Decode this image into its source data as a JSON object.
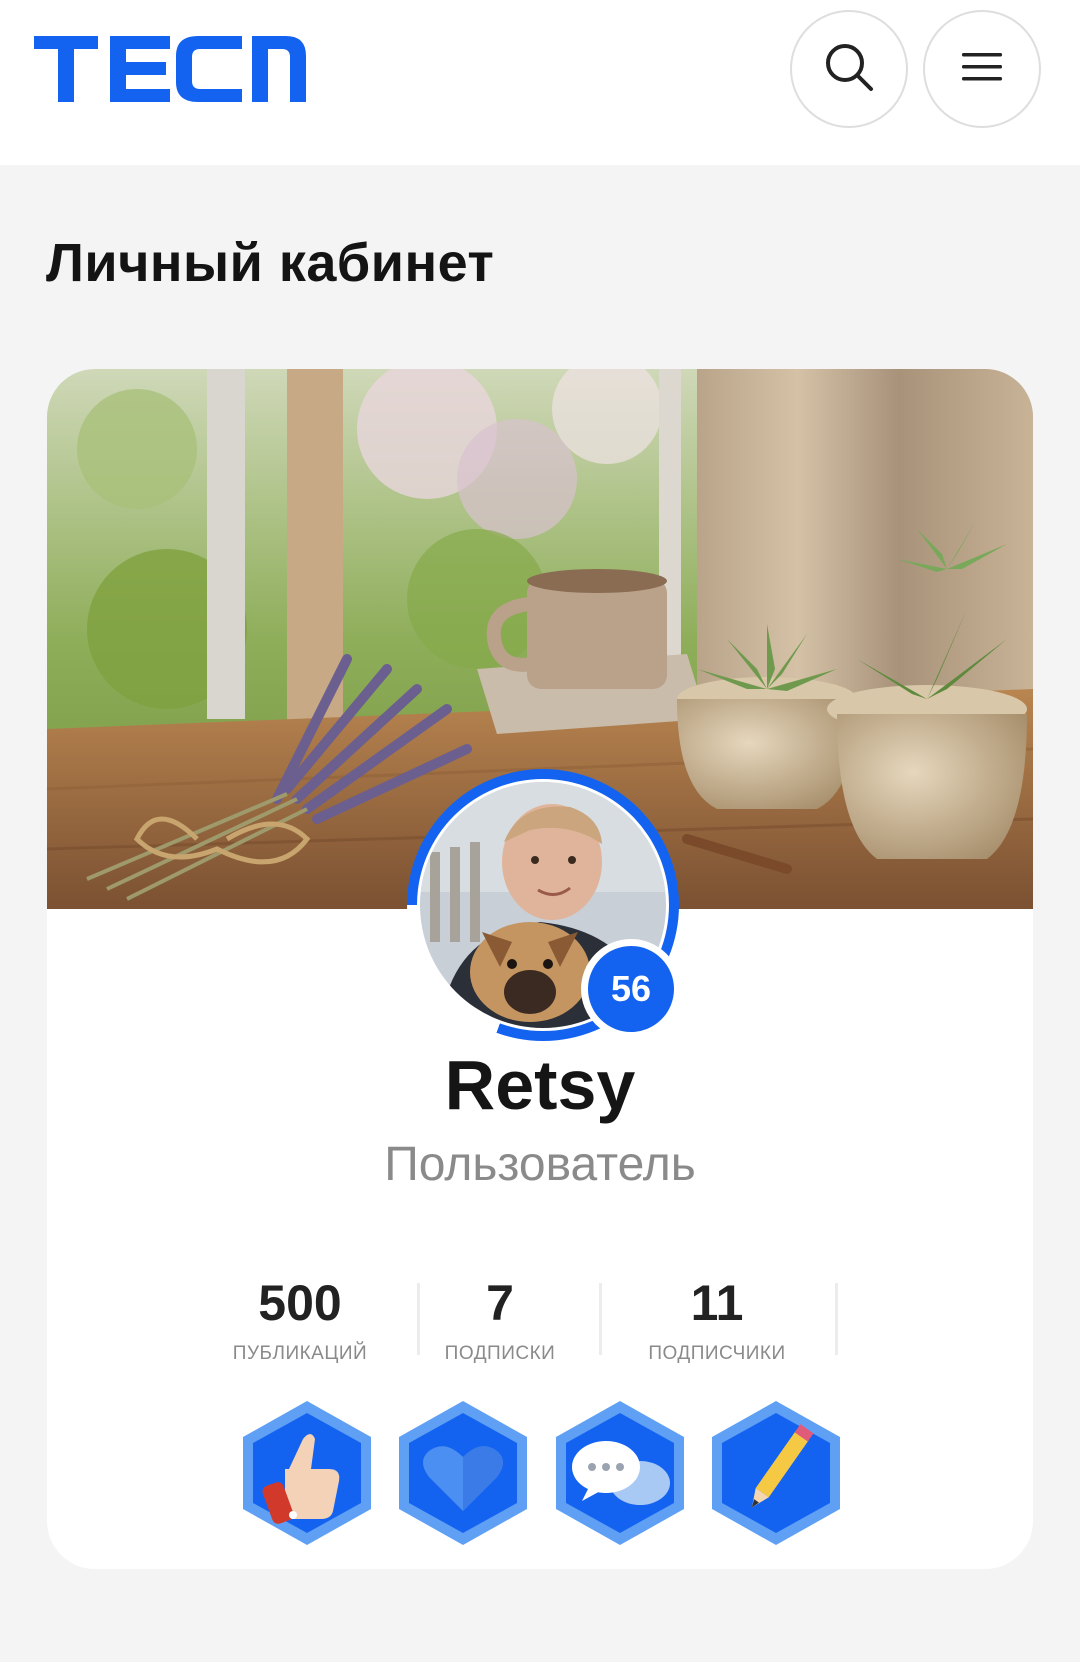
{
  "brand": {
    "logo_text": "TECNO",
    "accent_color": "#1463f0"
  },
  "header": {
    "search_icon": "search-icon",
    "menu_icon": "hamburger-menu-icon"
  },
  "page": {
    "title": "Личный кабинет"
  },
  "profile": {
    "cover_image": "cover-photo-lavender-succulents-coffee",
    "avatar_image": "avatar-photo-man-with-dog",
    "level": "56",
    "username": "Retsy",
    "role": "Пользователь"
  },
  "stats": [
    {
      "value": "500",
      "label": "ПУБЛИКАЦИЙ"
    },
    {
      "value": "7",
      "label": "ПОДПИСКИ"
    },
    {
      "value": "11",
      "label": "ПОДПИСЧИКИ"
    }
  ],
  "badges": [
    {
      "icon": "thumbs-up-icon"
    },
    {
      "icon": "heart-icon"
    },
    {
      "icon": "chat-bubbles-icon"
    },
    {
      "icon": "pencil-icon"
    }
  ]
}
